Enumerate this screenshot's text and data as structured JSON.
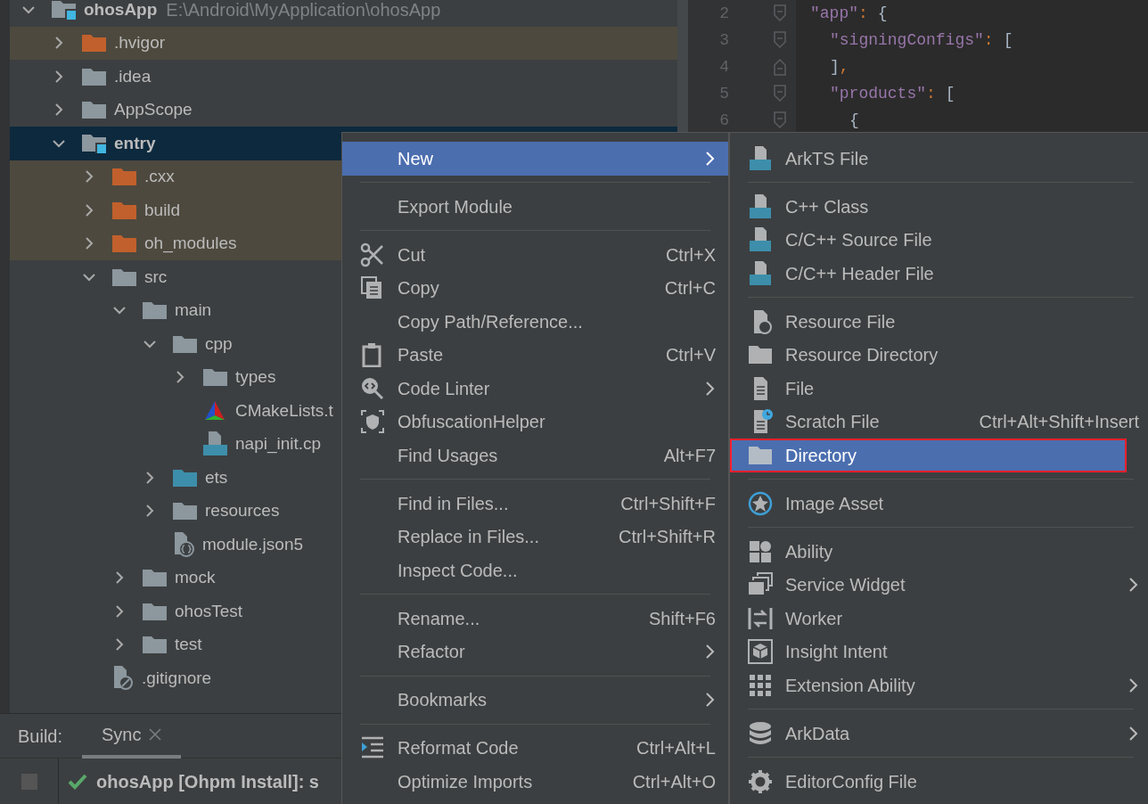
{
  "project_tree": [
    {
      "name": "ohosApp",
      "path": "E:\\Android\\MyApplication\\ohosApp",
      "kind": "module",
      "expanded": true,
      "selected": false,
      "children": [
        {
          "name": ".hvigor",
          "kind": "excluded_folder",
          "expanded": false,
          "selected": false
        },
        {
          "name": ".idea",
          "kind": "folder",
          "expanded": false,
          "selected": false
        },
        {
          "name": "AppScope",
          "kind": "folder",
          "expanded": false,
          "selected": false
        },
        {
          "name": "entry",
          "kind": "module",
          "expanded": true,
          "selected": true,
          "children": [
            {
              "name": ".cxx",
              "kind": "excluded_folder",
              "expanded": false,
              "selected": false
            },
            {
              "name": "build",
              "kind": "excluded_folder",
              "expanded": false,
              "selected": false
            },
            {
              "name": "oh_modules",
              "kind": "excluded_folder",
              "expanded": false,
              "selected": false
            },
            {
              "name": "src",
              "kind": "folder",
              "expanded": true,
              "selected": false,
              "children": [
                {
                  "name": "main",
                  "kind": "folder",
                  "expanded": true,
                  "selected": false,
                  "children": [
                    {
                      "name": "cpp",
                      "kind": "folder",
                      "expanded": true,
                      "selected": false,
                      "children": [
                        {
                          "name": "types",
                          "kind": "folder",
                          "expanded": false,
                          "selected": false
                        },
                        {
                          "name": "CMakeLists.t",
                          "kind": "cmake_file",
                          "selected": false
                        },
                        {
                          "name": "napi_init.cp",
                          "kind": "cpp_file",
                          "selected": false
                        }
                      ]
                    },
                    {
                      "name": "ets",
                      "kind": "source_folder",
                      "expanded": false,
                      "selected": false
                    },
                    {
                      "name": "resources",
                      "kind": "folder",
                      "expanded": false,
                      "selected": false
                    },
                    {
                      "name": "module.json5",
                      "kind": "json5_file",
                      "selected": false
                    }
                  ]
                },
                {
                  "name": "mock",
                  "kind": "folder",
                  "expanded": false,
                  "selected": false
                },
                {
                  "name": "ohosTest",
                  "kind": "folder",
                  "expanded": false,
                  "selected": false
                },
                {
                  "name": "test",
                  "kind": "folder",
                  "expanded": false,
                  "selected": false
                }
              ]
            },
            {
              "name": ".gitignore",
              "kind": "gitignore_file",
              "selected": false
            }
          ]
        }
      ]
    }
  ],
  "editor": {
    "lines": [
      {
        "number": "2",
        "fold_end": false,
        "tokens": [
          {
            "kind": "key",
            "text": "\"app\""
          },
          {
            "kind": "punct",
            "text": ":"
          },
          {
            "kind": "bracket",
            "text": "{"
          }
        ]
      },
      {
        "number": "3",
        "fold_end": false,
        "tokens": [
          {
            "kind": "key",
            "text": "\"signingConfigs\""
          },
          {
            "kind": "punct",
            "text": ":"
          },
          {
            "kind": "bracket",
            "text": "["
          }
        ]
      },
      {
        "number": "4",
        "fold_end": true,
        "tokens": [
          {
            "kind": "bracket",
            "text": "]"
          },
          {
            "kind": "punct",
            "text": ","
          }
        ]
      },
      {
        "number": "5",
        "fold_end": false,
        "tokens": [
          {
            "kind": "key",
            "text": "\"products\""
          },
          {
            "kind": "punct",
            "text": ":"
          },
          {
            "kind": "bracket",
            "text": "["
          }
        ]
      },
      {
        "number": "6",
        "fold_end": false,
        "tokens": [
          {
            "kind": "bracket",
            "text": "{"
          }
        ]
      }
    ]
  },
  "build_panel": {
    "label": "Build:",
    "tabs": [
      {
        "label": "Sync",
        "selected": true
      }
    ],
    "status": "ohosApp [Ohpm Install]: s"
  },
  "context_menu": [
    {
      "kind": "item",
      "label": "New",
      "submenu": true,
      "selected": true
    },
    {
      "kind": "separator"
    },
    {
      "kind": "item",
      "label": "Export Module",
      "submenu": false,
      "selected": false
    },
    {
      "kind": "separator"
    },
    {
      "kind": "item",
      "label": "Cut",
      "shortcut": "Ctrl+X",
      "submenu": false,
      "selected": false
    },
    {
      "kind": "item",
      "label": "Copy",
      "shortcut": "Ctrl+C",
      "submenu": false,
      "selected": false
    },
    {
      "kind": "item",
      "label": "Copy Path/Reference...",
      "submenu": false,
      "selected": false
    },
    {
      "kind": "item",
      "label": "Paste",
      "shortcut": "Ctrl+V",
      "submenu": false,
      "selected": false
    },
    {
      "kind": "item",
      "label": "Code Linter",
      "submenu": true,
      "selected": false
    },
    {
      "kind": "item",
      "label": "ObfuscationHelper",
      "submenu": false,
      "selected": false
    },
    {
      "kind": "item",
      "label": "Find Usages",
      "shortcut": "Alt+F7",
      "submenu": false,
      "selected": false
    },
    {
      "kind": "separator"
    },
    {
      "kind": "item",
      "label": "Find in Files...",
      "shortcut": "Ctrl+Shift+F",
      "submenu": false,
      "selected": false
    },
    {
      "kind": "item",
      "label": "Replace in Files...",
      "shortcut": "Ctrl+Shift+R",
      "submenu": false,
      "selected": false
    },
    {
      "kind": "item",
      "label": "Inspect Code...",
      "submenu": false,
      "selected": false
    },
    {
      "kind": "separator"
    },
    {
      "kind": "item",
      "label": "Rename...",
      "shortcut": "Shift+F6",
      "submenu": false,
      "selected": false
    },
    {
      "kind": "item",
      "label": "Refactor",
      "submenu": true,
      "selected": false
    },
    {
      "kind": "separator"
    },
    {
      "kind": "item",
      "label": "Bookmarks",
      "submenu": true,
      "selected": false
    },
    {
      "kind": "separator"
    },
    {
      "kind": "item",
      "label": "Reformat Code",
      "shortcut": "Ctrl+Alt+L",
      "submenu": false,
      "selected": false
    },
    {
      "kind": "item",
      "label": "Optimize Imports",
      "shortcut": "Ctrl+Alt+O",
      "submenu": false,
      "selected": false
    }
  ],
  "new_submenu": [
    {
      "kind": "item",
      "label": "ArkTS File",
      "submenu": false,
      "selected": false,
      "annotated": false
    },
    {
      "kind": "separator"
    },
    {
      "kind": "item",
      "label": "C++ Class",
      "submenu": false,
      "selected": false,
      "annotated": false
    },
    {
      "kind": "item",
      "label": "C/C++ Source File",
      "submenu": false,
      "selected": false,
      "annotated": false
    },
    {
      "kind": "item",
      "label": "C/C++ Header File",
      "submenu": false,
      "selected": false,
      "annotated": false
    },
    {
      "kind": "separator"
    },
    {
      "kind": "item",
      "label": "Resource File",
      "submenu": false,
      "selected": false,
      "annotated": false
    },
    {
      "kind": "item",
      "label": "Resource Directory",
      "submenu": false,
      "selected": false,
      "annotated": false
    },
    {
      "kind": "item",
      "label": "File",
      "submenu": false,
      "selected": false,
      "annotated": false
    },
    {
      "kind": "item",
      "label": "Scratch File",
      "shortcut": "Ctrl+Alt+Shift+Insert",
      "submenu": false,
      "selected": false,
      "annotated": false
    },
    {
      "kind": "item",
      "label": "Directory",
      "submenu": false,
      "selected": true,
      "annotated": true
    },
    {
      "kind": "separator"
    },
    {
      "kind": "item",
      "label": "Image Asset",
      "submenu": false,
      "selected": false,
      "annotated": false
    },
    {
      "kind": "separator"
    },
    {
      "kind": "item",
      "label": "Ability",
      "submenu": false,
      "selected": false,
      "annotated": false
    },
    {
      "kind": "item",
      "label": "Service Widget",
      "submenu": true,
      "selected": false,
      "annotated": false
    },
    {
      "kind": "item",
      "label": "Worker",
      "submenu": false,
      "selected": false,
      "annotated": false
    },
    {
      "kind": "item",
      "label": "Insight Intent",
      "submenu": false,
      "selected": false,
      "annotated": false
    },
    {
      "kind": "item",
      "label": "Extension Ability",
      "submenu": true,
      "selected": false,
      "annotated": false
    },
    {
      "kind": "separator"
    },
    {
      "kind": "item",
      "label": "ArkData",
      "submenu": true,
      "selected": false,
      "annotated": false
    },
    {
      "kind": "separator"
    },
    {
      "kind": "item",
      "label": "EditorConfig File",
      "submenu": false,
      "selected": false,
      "annotated": false
    }
  ]
}
